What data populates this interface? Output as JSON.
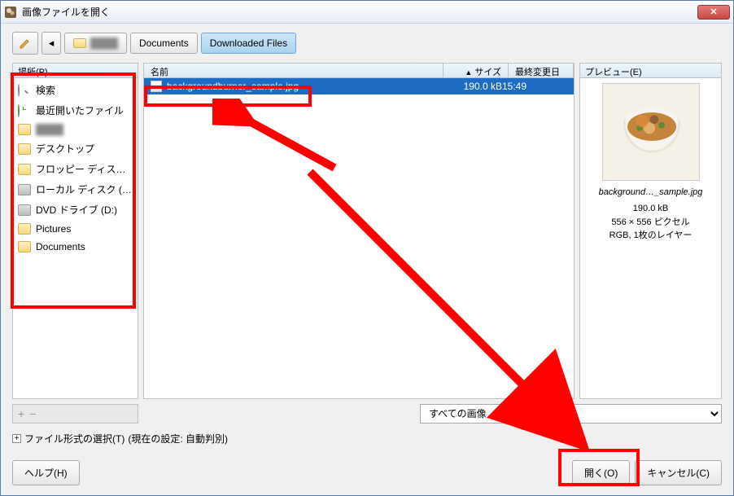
{
  "titlebar": {
    "title": "画像ファイルを開く"
  },
  "path": {
    "user_folder": "████",
    "documents": "Documents",
    "downloaded": "Downloaded Files"
  },
  "places": {
    "header": "場所(P)",
    "items": [
      {
        "label": "検索",
        "icon": "search"
      },
      {
        "label": "最近開いたファイル",
        "icon": "clock"
      },
      {
        "label": "████",
        "icon": "folder",
        "blurred": true
      },
      {
        "label": "デスクトップ",
        "icon": "folder"
      },
      {
        "label": "フロッピー ディス…",
        "icon": "folder"
      },
      {
        "label": "ローカル ディスク (…",
        "icon": "drive"
      },
      {
        "label": "DVD ドライブ (D:)",
        "icon": "drive"
      },
      {
        "label": "Pictures",
        "icon": "folder"
      },
      {
        "label": "Documents",
        "icon": "folder"
      }
    ]
  },
  "files": {
    "headers": {
      "name": "名前",
      "size": "サイズ",
      "date": "最終変更日"
    },
    "rows": [
      {
        "name": "backgroundburner_sample.jpg",
        "size": "190.0 kB",
        "date": "15:49",
        "selected": true
      }
    ]
  },
  "preview": {
    "header": "プレビュー(E)",
    "filename": "background…_sample.jpg",
    "filesize": "190.0 kB",
    "dimensions": "556 × 556 ピクセル",
    "colormode": "RGB, 1枚のレイヤー"
  },
  "filter": {
    "selected": "すべての画像"
  },
  "expander": {
    "label": "ファイル形式の選択(T)",
    "current": "(現在の設定: 自動判別)"
  },
  "buttons": {
    "help": "ヘルプ(H)",
    "open": "開く(O)",
    "cancel": "キャンセル(C)"
  }
}
